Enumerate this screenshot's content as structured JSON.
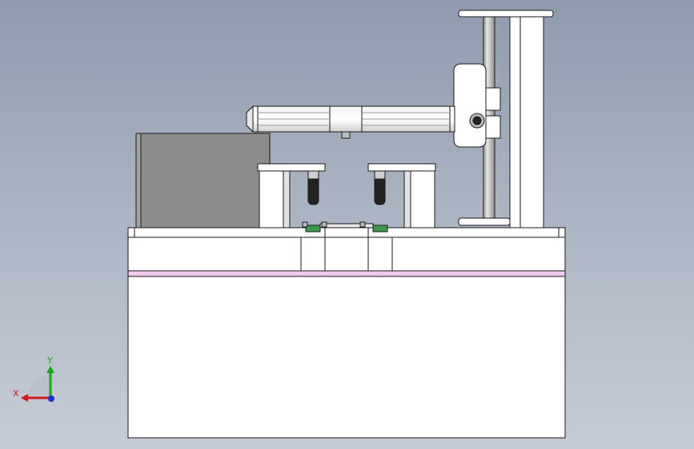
{
  "viewport": {
    "view": "front",
    "background_top": "#8f9bad",
    "background_bottom": "#c6ccd6"
  },
  "colors": {
    "part_fill": "#ffffff",
    "part_edge": "#1a1a1a",
    "shaded_gray": "#c8c8c8",
    "cover_box": "#8c8c8c",
    "pink_layer": "#f3c8ee",
    "clamp_black": "#222222",
    "green_parts": "#3d9a4a"
  },
  "model": {
    "parts": [
      "base-frame",
      "pink-layer",
      "top-plate",
      "cover-box",
      "left-bracket",
      "right-bracket",
      "left-clamp",
      "right-clamp",
      "fixture-center",
      "cylinder-arm",
      "column-rod",
      "column-post",
      "column-cap",
      "slide-block"
    ]
  },
  "triad": {
    "x_label": "X",
    "y_label": "Y",
    "x_color": "#d11a1a",
    "y_color": "#18a818",
    "z_color": "#1a2fd1"
  }
}
